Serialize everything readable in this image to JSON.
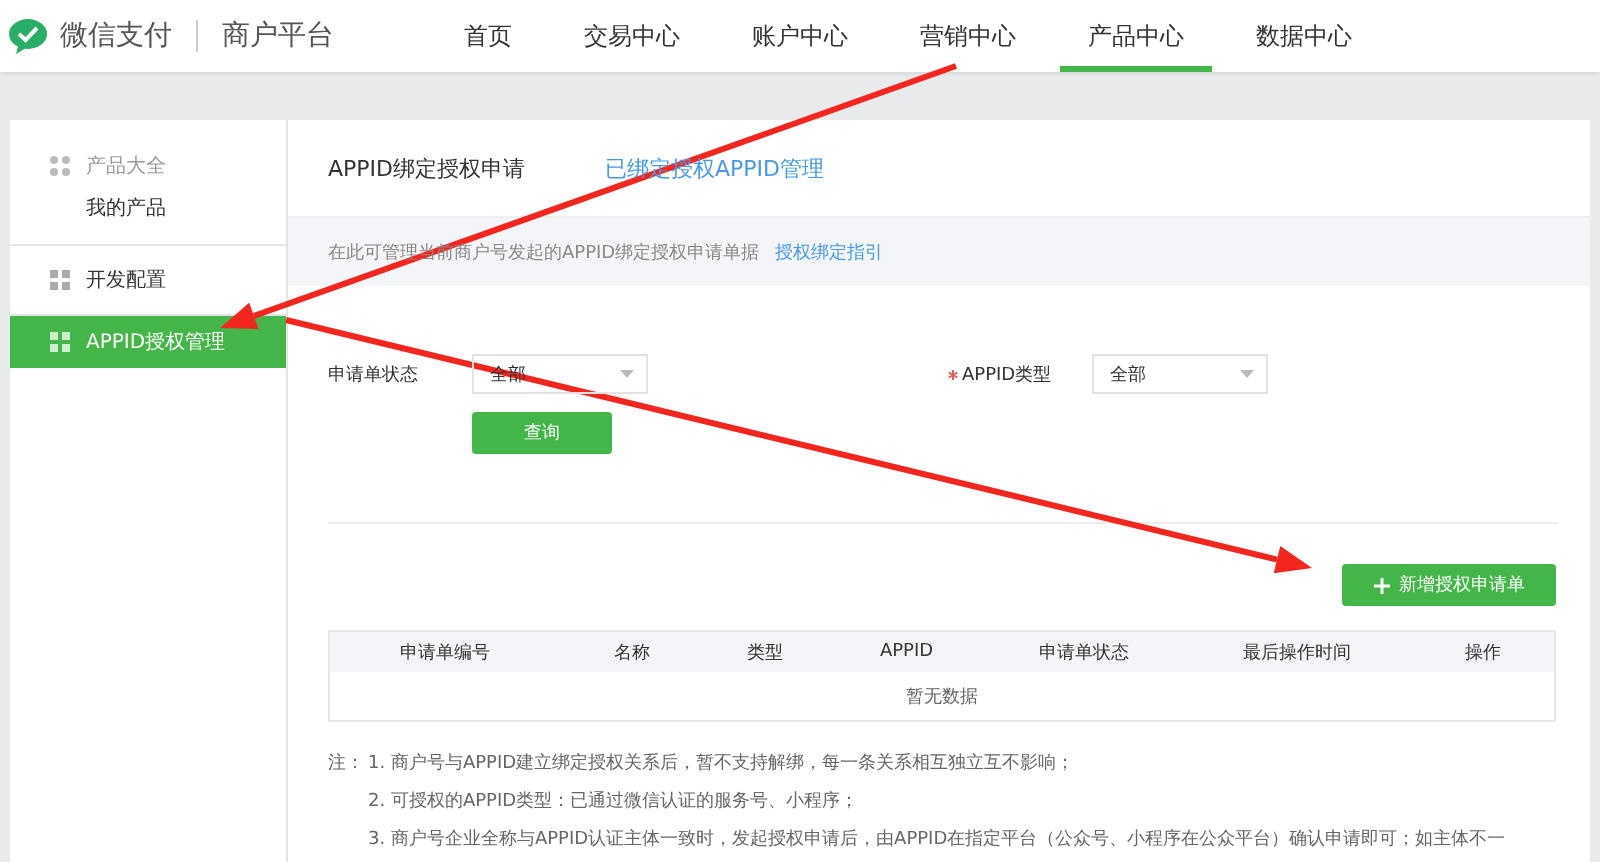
{
  "header": {
    "logo_text": "微信支付",
    "platform": "商户平台",
    "nav": [
      {
        "label": "首页",
        "selected": false
      },
      {
        "label": "交易中心",
        "selected": false
      },
      {
        "label": "账户中心",
        "selected": false
      },
      {
        "label": "营销中心",
        "selected": false
      },
      {
        "label": "产品中心",
        "selected": true
      },
      {
        "label": "数据中心",
        "selected": false
      }
    ]
  },
  "sidebar": {
    "items": [
      {
        "label": "产品大全",
        "kind": "group",
        "selected": false,
        "children": [
          {
            "label": "我的产品",
            "selected": false
          }
        ]
      },
      {
        "label": "开发配置",
        "kind": "item",
        "selected": false
      },
      {
        "label": "APPID授权管理",
        "kind": "item",
        "selected": true
      }
    ]
  },
  "tabs": [
    {
      "label": "APPID绑定授权申请",
      "selected": true
    },
    {
      "label": "已绑定授权APPID管理",
      "selected": false
    }
  ],
  "info_bar": {
    "text": "在此可管理当前商户号发起的APPID绑定授权申请单据",
    "link": "授权绑定指引"
  },
  "filters": [
    {
      "label": "申请单状态",
      "required": false,
      "value": "全部"
    },
    {
      "label": "APPID类型",
      "required": true,
      "value": "全部"
    }
  ],
  "query_button": "查询",
  "add_button": "新增授权申请单",
  "table": {
    "columns": [
      "申请单编号",
      "名称",
      "类型",
      "APPID",
      "申请单状态",
      "最后操作时间",
      "操作"
    ],
    "empty_text": "暂无数据"
  },
  "notes": {
    "label": "注：",
    "items": [
      "1. 商户号与APPID建立绑定授权关系后，暂不支持解绑，每一条关系相互独立互不影响；",
      "2. 可授权的APPID类型：已通过微信认证的服务号、小程序；",
      "3. 商户号企业全称与APPID认证主体一致时，发起授权申请后，由APPID在指定平台（公众号、小程序在公众平台）确认申请即可；如主体不一"
    ]
  }
}
